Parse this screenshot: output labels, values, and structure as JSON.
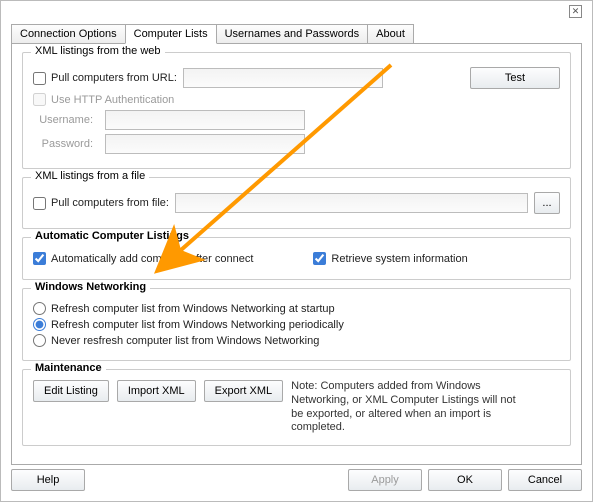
{
  "tabs": {
    "connection": "Connection Options",
    "computer": "Computer Lists",
    "usernames": "Usernames and Passwords",
    "about": "About"
  },
  "web": {
    "title": "XML listings from the web",
    "pull_url": "Pull computers from URL:",
    "test": "Test",
    "use_http": "Use HTTP Authentication",
    "username": "Username:",
    "password": "Password:"
  },
  "file": {
    "title": "XML listings from a file",
    "pull_file": "Pull computers from file:",
    "browse": "..."
  },
  "auto": {
    "title": "Automatic Computer Listings",
    "add_after": "Automatically add computer after connect",
    "retrieve": "Retrieve system information"
  },
  "winnet": {
    "title": "Windows Networking",
    "r1": "Refresh computer list from Windows Networking at startup",
    "r2": "Refresh computer list from Windows Networking periodically",
    "r3": "Never resfresh computer list from Windows Networking"
  },
  "maint": {
    "title": "Maintenance",
    "edit": "Edit Listing",
    "import": "Import XML",
    "export": "Export XML",
    "note": "Note: Computers added from Windows Networking, or XML Computer Listings will not be exported, or altered when an import is completed."
  },
  "footer": {
    "help": "Help",
    "apply": "Apply",
    "ok": "OK",
    "cancel": "Cancel"
  }
}
